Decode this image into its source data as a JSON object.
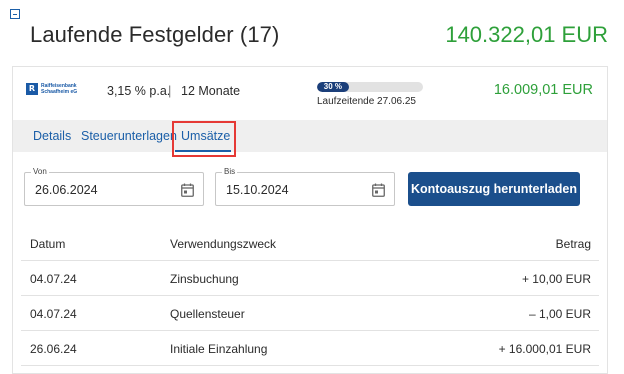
{
  "group": {
    "title": "Laufende Festgelder (17)",
    "total": "140.322,01 EUR"
  },
  "deposit": {
    "bank_logo_mark": "R",
    "bank_name_line1": "Raiffeisenbank",
    "bank_name_line2": "Schaafheim eG",
    "rate": "3,15 % p.a.",
    "separator": "|",
    "duration": "12 Monate",
    "progress_label": "30 %",
    "progress_fraction": 0.3,
    "maturity": "Laufzeitende 27.06.25",
    "amount": "16.009,01 EUR"
  },
  "tabs": [
    {
      "label": "Details"
    },
    {
      "label": "Steuerunterlagen"
    },
    {
      "label": "Umsätze"
    }
  ],
  "filters": {
    "from_label": "Von",
    "from_value": "26.06.2024",
    "to_label": "Bis",
    "to_value": "15.10.2024",
    "download_label": "Kontoauszug herunterladen"
  },
  "table": {
    "headers": {
      "date": "Datum",
      "purpose": "Verwendungszweck",
      "amount": "Betrag"
    },
    "rows": [
      {
        "date": "04.07.24",
        "purpose": "Zinsbuchung",
        "amount": "+ 10,00 EUR"
      },
      {
        "date": "04.07.24",
        "purpose": "Quellensteuer",
        "amount": "– 1,00 EUR"
      },
      {
        "date": "26.06.24",
        "purpose": "Initiale Einzahlung",
        "amount": "+ 16.000,01 EUR"
      }
    ]
  },
  "colors": {
    "accent": "#1b5fa8",
    "positive": "#2ea03a",
    "button": "#1b4f8c",
    "highlight": "#e53935"
  },
  "icons": {
    "collapse": "minus-box-icon",
    "calendar": "calendar-icon"
  }
}
